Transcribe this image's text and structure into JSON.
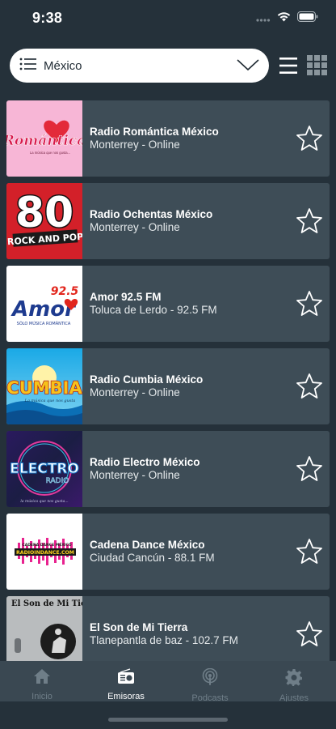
{
  "status": {
    "time": "9:38"
  },
  "header": {
    "country": "México"
  },
  "stations": [
    {
      "name": "Radio Romántica México",
      "subtitle": "Monterrey - Online",
      "logo_text": "Romántica",
      "logo_tagline": "La música que nos gusta...",
      "icon": "romantica-logo"
    },
    {
      "name": "Radio Ochentas México",
      "subtitle": "Monterrey - Online",
      "logo_text": "80",
      "logo_tagline": "ROCK AND POP",
      "icon": "ochentas-logo"
    },
    {
      "name": "Amor 92.5 FM",
      "subtitle": "Toluca de Lerdo - 92.5 FM",
      "logo_text": "Amor",
      "logo_freq": "92.5",
      "logo_tagline": "SÓLO MÚSICA ROMÁNTICA",
      "icon": "amor-logo"
    },
    {
      "name": "Radio Cumbia México",
      "subtitle": "Monterrey - Online",
      "logo_text": "CUMBIA",
      "logo_tagline": "La música que nos gusta",
      "icon": "cumbia-logo"
    },
    {
      "name": "Radio Electro México",
      "subtitle": "Monterrey - Online",
      "logo_text": "ELECTRO",
      "logo_sub": "RADIO",
      "logo_tagline": "la música que nos gusta...",
      "icon": "electro-logo"
    },
    {
      "name": "Cadena Dance México",
      "subtitle": "Ciudad Cancún - 88.1 FM",
      "logo_text": "RADIOINDANCE.COM",
      "logo_top": "CADENA DANCE MÉXICO",
      "icon": "dance-logo"
    },
    {
      "name": "El Son de Mi Tierra",
      "subtitle": "Tlanepantla de baz - 102.7 FM",
      "logo_text": "El Son de Mi Tierra",
      "icon": "son-logo"
    }
  ],
  "tabs": [
    {
      "label": "Inicio",
      "icon": "home-icon",
      "active": false
    },
    {
      "label": "Emisoras",
      "icon": "radio-icon",
      "active": true
    },
    {
      "label": "Podcasts",
      "icon": "podcast-icon",
      "active": false
    },
    {
      "label": "Ajustes",
      "icon": "gear-icon",
      "active": false
    }
  ],
  "colors": {
    "background": "#25313a",
    "card": "#3e4d57",
    "tab_bar": "#3a4852",
    "active_tab": "#ffffff",
    "inactive_tab": "#6f7e88"
  }
}
